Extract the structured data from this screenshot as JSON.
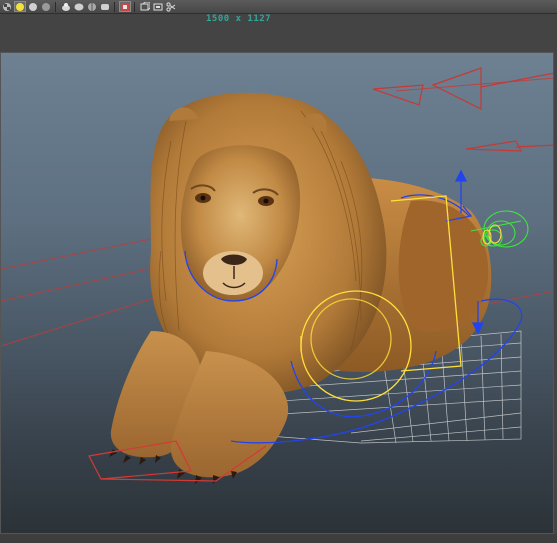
{
  "viewport": {
    "resolution_label": "1500 x 1127"
  },
  "toolbar": {
    "buttons": [
      {
        "icon": "checker-sphere-icon"
      },
      {
        "icon": "light-sphere-icon"
      },
      {
        "icon": "shaded-sphere-icon"
      },
      {
        "icon": "dark-sphere-icon"
      },
      {
        "icon": "isolate-select-icon"
      },
      {
        "icon": "xray-icon"
      },
      {
        "icon": "xray-joints-icon"
      },
      {
        "icon": "smooth-mesh-icon"
      },
      {
        "icon": "image-plane-icon"
      },
      {
        "icon": "camera-gate-icon"
      },
      {
        "icon": "resolution-gate-icon"
      },
      {
        "icon": "scissors-icon"
      }
    ]
  },
  "colors": {
    "resolution_text": "#2fa89a",
    "controller_red": "#c43a35",
    "controller_blue": "#2244ee",
    "controller_yellow": "#ffe03a",
    "controller_green": "#3de63d",
    "grid_white": "#e8e8e8"
  }
}
